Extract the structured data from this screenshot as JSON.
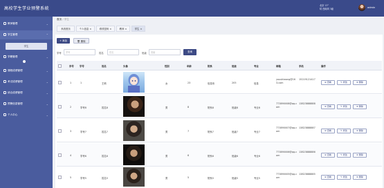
{
  "header": {
    "app_title": "高校学生学业预警系统",
    "weather_line1": "北京 13°",
    "weather_line2": "晴  西南风 3级",
    "admin_name": "admin"
  },
  "sidebar": {
    "items": [
      {
        "label": "教师管理"
      },
      {
        "label": "学生管理"
      },
      {
        "label": "学籍管理"
      },
      {
        "label": "课程成绩管理"
      },
      {
        "label": "考试成绩管理"
      },
      {
        "label": "综合成绩管理"
      },
      {
        "label": "预警信息管理"
      },
      {
        "label": "个人中心"
      }
    ],
    "sub_item": "学生"
  },
  "breadcrumb": {
    "home": "首页",
    "sep": "/",
    "current": "学生"
  },
  "tabs": [
    "系统首页",
    "个人信息 ×",
    "修改密码 ×",
    "教师 ×",
    "学生 ×"
  ],
  "toolbar": {
    "add_label": "+ 添加",
    "delete_label": "🗑 删除"
  },
  "filters": {
    "f1_label": "学号",
    "f1_placeholder": "学号",
    "f2_label": "姓名",
    "f2_placeholder": "姓名",
    "f3_label": "班级",
    "f3_placeholder": "班级",
    "search_label": "查询"
  },
  "table": {
    "columns": [
      "序号",
      "学号",
      "姓名",
      "头像",
      "性别",
      "年龄",
      "院系",
      "班级",
      "专业",
      "邮箱",
      "手机",
      "操作"
    ],
    "rows": [
      {
        "idx": "1",
        "sid": "1",
        "name": "王莉",
        "gender": "女",
        "age": "23",
        "dept": "信息系",
        "cls": "205",
        "major": "信息",
        "email": "youshiwang@163.com",
        "phone": "15219121417"
      },
      {
        "idx": "2",
        "sid": "学号8",
        "name": "姓名8",
        "gender": "男",
        "age": "8",
        "dept": "院系8",
        "cls": "班级8",
        "major": "专业8",
        "email": "773890008@qq.com",
        "phone": "13823888888"
      },
      {
        "idx": "3",
        "sid": "学号7",
        "name": "姓名7",
        "gender": "男",
        "age": "7",
        "dept": "院系7",
        "cls": "班级7",
        "major": "专业7",
        "email": "773890007@qq.com",
        "phone": "13823888887"
      },
      {
        "idx": "4",
        "sid": "学号6",
        "name": "姓名6",
        "gender": "男",
        "age": "6",
        "dept": "院系6",
        "cls": "班级6",
        "major": "专业6",
        "email": "773890006@qq.com",
        "phone": "13823888886"
      },
      {
        "idx": "5",
        "sid": "学号5",
        "name": "姓名5",
        "gender": "男",
        "age": "5",
        "dept": "院系5",
        "cls": "班级5",
        "major": "专业5",
        "email": "773890005@qq.com",
        "phone": "13823888885"
      }
    ],
    "actions": {
      "view": "查看",
      "edit": "修改",
      "delete": "删除"
    }
  }
}
